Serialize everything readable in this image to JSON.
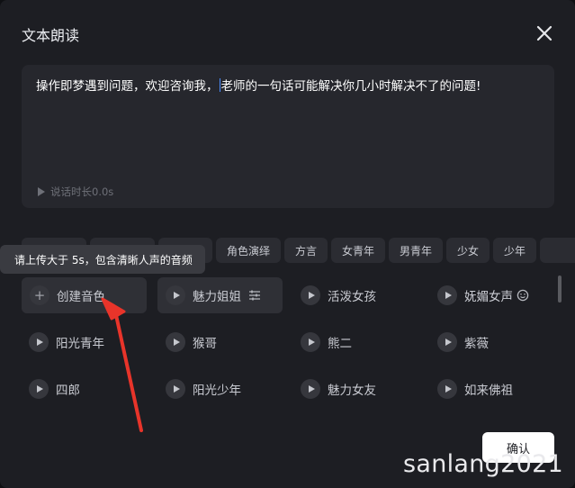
{
  "dialog": {
    "title": "文本朗读",
    "close_icon": "close-icon"
  },
  "text_input": {
    "before_caret": "操作即梦遇到问题，欢迎咨询我，",
    "after_caret": "老师的一句话可能解决你几小时解决不了的问题!"
  },
  "duration": {
    "label": "说话时长0.0s",
    "icon": "play-icon"
  },
  "tags": [
    "角色演绎",
    "方言",
    "女青年",
    "男青年",
    "少女",
    "少年"
  ],
  "tooltip": "请上传大于 5s，包含清晰人声的音频",
  "voices": [
    {
      "label": "创建音色",
      "icon": "plus-icon"
    },
    {
      "label": "魅力姐姐",
      "icon": "play-icon",
      "suffix": "sliders-icon"
    },
    {
      "label": "活泼女孩",
      "icon": "play-icon"
    },
    {
      "label": "妩媚女声",
      "icon": "play-icon",
      "suffix": "smile-icon"
    },
    {
      "label": "阳光青年",
      "icon": "play-icon"
    },
    {
      "label": "猴哥",
      "icon": "play-icon"
    },
    {
      "label": "熊二",
      "icon": "play-icon"
    },
    {
      "label": "紫薇",
      "icon": "play-icon"
    },
    {
      "label": "四郎",
      "icon": "play-icon"
    },
    {
      "label": "阳光少年",
      "icon": "play-icon"
    },
    {
      "label": "魅力女友",
      "icon": "play-icon"
    },
    {
      "label": "如来佛祖",
      "icon": "play-icon"
    }
  ],
  "confirm_label": "确认",
  "watermark": "sanlang2021",
  "colors": {
    "accent_arrow": "#e8342a",
    "caret": "#4a8cff"
  }
}
